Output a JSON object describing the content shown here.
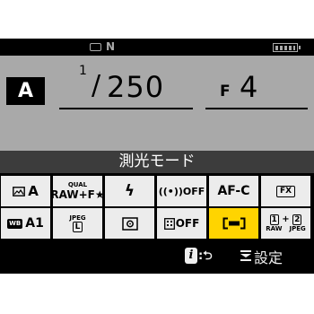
{
  "status": {
    "mode_indicator": "N"
  },
  "exposure": {
    "mode": "A",
    "shutter_numerator": "1",
    "shutter_slash": "/",
    "shutter_denominator": "250",
    "aperture_prefix": "F",
    "aperture_value": "4"
  },
  "menu_title": "測光モード",
  "grid": {
    "row1": {
      "picture_control": "A",
      "quality_label": "QUAL",
      "quality_value": "RAW+F★",
      "flash": "ϟ",
      "wireless": "((•))OFF",
      "af_mode": "AF-C",
      "image_area": "FX"
    },
    "row2": {
      "wb_box": "WB",
      "wb_value": "A1",
      "jpeg_label": "JPEG",
      "jpeg_size": "L",
      "nr_value": "OFF",
      "slot1": "1",
      "slot_plus": "+",
      "slot2": "2",
      "raw_label": "RAW",
      "slot_jpeg_label": "JPEG"
    }
  },
  "bottom": {
    "i_label": "i",
    "return_label": ":⮌",
    "settings_label": "設定"
  }
}
